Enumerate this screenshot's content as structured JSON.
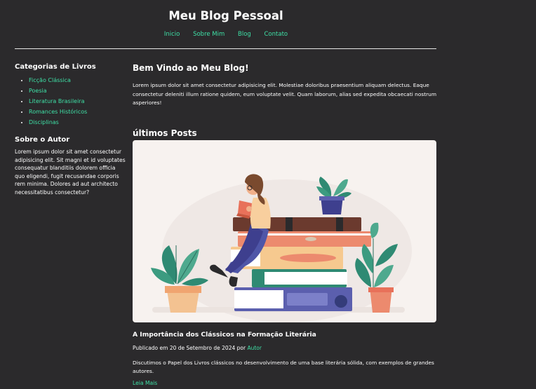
{
  "header": {
    "title": "Meu Blog Pessoal",
    "nav": [
      "Inicio",
      "Sobre Mim",
      "Blog",
      "Contato"
    ]
  },
  "sidebar": {
    "categories_title": "Categorias de Livros",
    "categories": [
      "Ficção Clássica",
      "Poesia",
      "Literatura Brasileira",
      "Romances Históricos",
      "Disciplinas"
    ],
    "about_title": "Sobre o Autor",
    "about_text": "Lorem ipsum dolor sit amet consectetur adipisicing elit. Sit magni et id voluptates consequatur blanditiis dolorem officia quo eligendi, fugit recusandae corporis rem minima. Dolores ad aut architecto necessitatibus consectetur?"
  },
  "main": {
    "welcome_title": "Bem Vindo ao Meu Blog!",
    "welcome_text": "Lorem ipsum dolor sit amet consectetur adipisicing elit. Molestiae doloribus praesentium aliquam delectus. Eaque consectetur deleniti illum ratione quidem, eum voluptate velit. Quam laborum, alias sed expedita obcaecati nostrum asperiores!",
    "latest_title": "últimos Posts"
  },
  "post": {
    "title": "A Importância dos Clássicos na Formação Literária",
    "meta_prefix": "Publicado em 20 de Setembro de 2024 por ",
    "author": "Autor",
    "excerpt": "Discutimos o Papel dos Livros clássicos no desenvolvimento de uma base literária sólida, com exemplos de grandes autores.",
    "read_more": "Leia Mais"
  },
  "colors": {
    "background": "#2b2a2c",
    "accent": "#3ee0a6",
    "text": "#ffffff"
  }
}
